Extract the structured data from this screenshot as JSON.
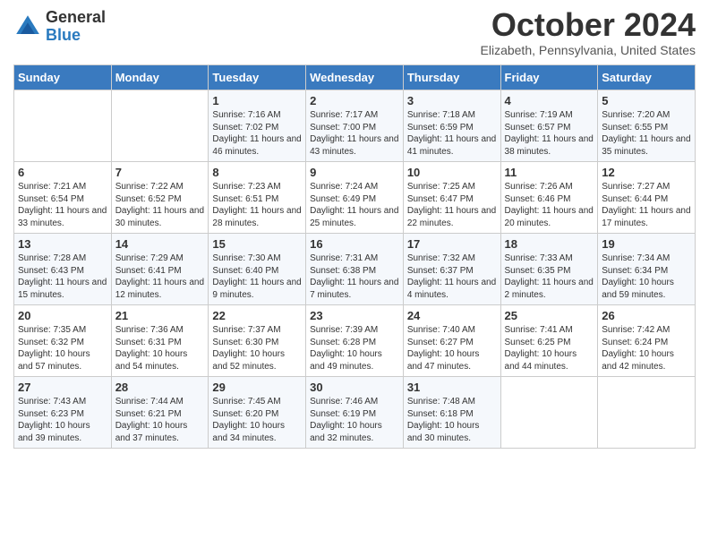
{
  "header": {
    "logo_general": "General",
    "logo_blue": "Blue",
    "month_title": "October 2024",
    "location": "Elizabeth, Pennsylvania, United States"
  },
  "days_of_week": [
    "Sunday",
    "Monday",
    "Tuesday",
    "Wednesday",
    "Thursday",
    "Friday",
    "Saturday"
  ],
  "weeks": [
    [
      {
        "day": "",
        "info": ""
      },
      {
        "day": "",
        "info": ""
      },
      {
        "day": "1",
        "info": "Sunrise: 7:16 AM\nSunset: 7:02 PM\nDaylight: 11 hours and 46 minutes."
      },
      {
        "day": "2",
        "info": "Sunrise: 7:17 AM\nSunset: 7:00 PM\nDaylight: 11 hours and 43 minutes."
      },
      {
        "day": "3",
        "info": "Sunrise: 7:18 AM\nSunset: 6:59 PM\nDaylight: 11 hours and 41 minutes."
      },
      {
        "day": "4",
        "info": "Sunrise: 7:19 AM\nSunset: 6:57 PM\nDaylight: 11 hours and 38 minutes."
      },
      {
        "day": "5",
        "info": "Sunrise: 7:20 AM\nSunset: 6:55 PM\nDaylight: 11 hours and 35 minutes."
      }
    ],
    [
      {
        "day": "6",
        "info": "Sunrise: 7:21 AM\nSunset: 6:54 PM\nDaylight: 11 hours and 33 minutes."
      },
      {
        "day": "7",
        "info": "Sunrise: 7:22 AM\nSunset: 6:52 PM\nDaylight: 11 hours and 30 minutes."
      },
      {
        "day": "8",
        "info": "Sunrise: 7:23 AM\nSunset: 6:51 PM\nDaylight: 11 hours and 28 minutes."
      },
      {
        "day": "9",
        "info": "Sunrise: 7:24 AM\nSunset: 6:49 PM\nDaylight: 11 hours and 25 minutes."
      },
      {
        "day": "10",
        "info": "Sunrise: 7:25 AM\nSunset: 6:47 PM\nDaylight: 11 hours and 22 minutes."
      },
      {
        "day": "11",
        "info": "Sunrise: 7:26 AM\nSunset: 6:46 PM\nDaylight: 11 hours and 20 minutes."
      },
      {
        "day": "12",
        "info": "Sunrise: 7:27 AM\nSunset: 6:44 PM\nDaylight: 11 hours and 17 minutes."
      }
    ],
    [
      {
        "day": "13",
        "info": "Sunrise: 7:28 AM\nSunset: 6:43 PM\nDaylight: 11 hours and 15 minutes."
      },
      {
        "day": "14",
        "info": "Sunrise: 7:29 AM\nSunset: 6:41 PM\nDaylight: 11 hours and 12 minutes."
      },
      {
        "day": "15",
        "info": "Sunrise: 7:30 AM\nSunset: 6:40 PM\nDaylight: 11 hours and 9 minutes."
      },
      {
        "day": "16",
        "info": "Sunrise: 7:31 AM\nSunset: 6:38 PM\nDaylight: 11 hours and 7 minutes."
      },
      {
        "day": "17",
        "info": "Sunrise: 7:32 AM\nSunset: 6:37 PM\nDaylight: 11 hours and 4 minutes."
      },
      {
        "day": "18",
        "info": "Sunrise: 7:33 AM\nSunset: 6:35 PM\nDaylight: 11 hours and 2 minutes."
      },
      {
        "day": "19",
        "info": "Sunrise: 7:34 AM\nSunset: 6:34 PM\nDaylight: 10 hours and 59 minutes."
      }
    ],
    [
      {
        "day": "20",
        "info": "Sunrise: 7:35 AM\nSunset: 6:32 PM\nDaylight: 10 hours and 57 minutes."
      },
      {
        "day": "21",
        "info": "Sunrise: 7:36 AM\nSunset: 6:31 PM\nDaylight: 10 hours and 54 minutes."
      },
      {
        "day": "22",
        "info": "Sunrise: 7:37 AM\nSunset: 6:30 PM\nDaylight: 10 hours and 52 minutes."
      },
      {
        "day": "23",
        "info": "Sunrise: 7:39 AM\nSunset: 6:28 PM\nDaylight: 10 hours and 49 minutes."
      },
      {
        "day": "24",
        "info": "Sunrise: 7:40 AM\nSunset: 6:27 PM\nDaylight: 10 hours and 47 minutes."
      },
      {
        "day": "25",
        "info": "Sunrise: 7:41 AM\nSunset: 6:25 PM\nDaylight: 10 hours and 44 minutes."
      },
      {
        "day": "26",
        "info": "Sunrise: 7:42 AM\nSunset: 6:24 PM\nDaylight: 10 hours and 42 minutes."
      }
    ],
    [
      {
        "day": "27",
        "info": "Sunrise: 7:43 AM\nSunset: 6:23 PM\nDaylight: 10 hours and 39 minutes."
      },
      {
        "day": "28",
        "info": "Sunrise: 7:44 AM\nSunset: 6:21 PM\nDaylight: 10 hours and 37 minutes."
      },
      {
        "day": "29",
        "info": "Sunrise: 7:45 AM\nSunset: 6:20 PM\nDaylight: 10 hours and 34 minutes."
      },
      {
        "day": "30",
        "info": "Sunrise: 7:46 AM\nSunset: 6:19 PM\nDaylight: 10 hours and 32 minutes."
      },
      {
        "day": "31",
        "info": "Sunrise: 7:48 AM\nSunset: 6:18 PM\nDaylight: 10 hours and 30 minutes."
      },
      {
        "day": "",
        "info": ""
      },
      {
        "day": "",
        "info": ""
      }
    ]
  ]
}
